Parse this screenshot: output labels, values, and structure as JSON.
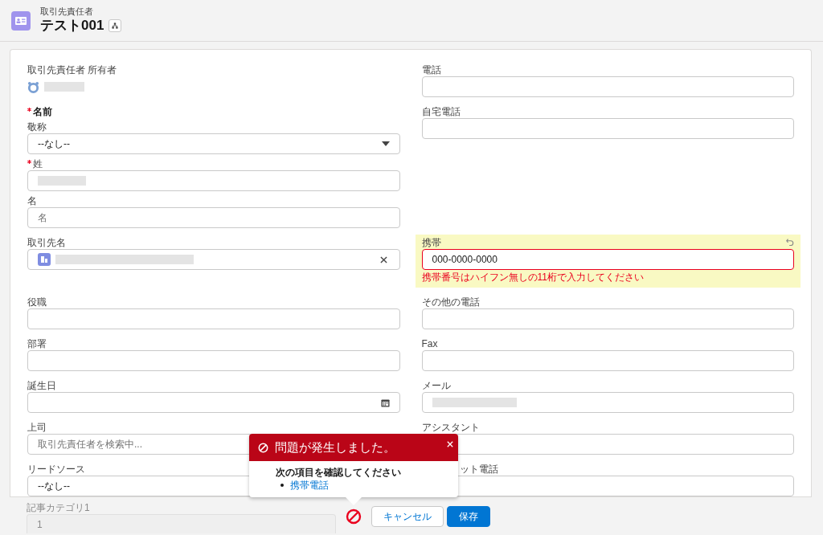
{
  "header": {
    "object_type": "取引先責任者",
    "title": "テスト001"
  },
  "rows": [
    {
      "left": {
        "kind": "owner",
        "label": "取引先責任者 所有者"
      },
      "right": {
        "kind": "text",
        "label": "電話"
      }
    },
    {
      "left": {
        "kind": "name",
        "label": "名前",
        "required": true,
        "subfields": [
          {
            "kind": "select",
            "label": "敬称",
            "value": "--なし--"
          },
          {
            "kind": "text",
            "label": "姓",
            "required": true,
            "redacted": true
          },
          {
            "kind": "text",
            "label": "名",
            "placeholder": "名"
          }
        ]
      },
      "right": {
        "kind": "text",
        "label": "自宅電話"
      }
    },
    {
      "left": {
        "kind": "lookup",
        "label": "取引先名",
        "redacted": true
      },
      "right": {
        "kind": "text",
        "label": "携帯",
        "value": "000-0000-0000",
        "changed": true,
        "error": "携帯番号はハイフン無しの11桁で入力してください"
      }
    },
    {
      "left": {
        "kind": "text",
        "label": "役職"
      },
      "right": {
        "kind": "text",
        "label": "その他の電話"
      }
    },
    {
      "left": {
        "kind": "text",
        "label": "部署"
      },
      "right": {
        "kind": "text",
        "label": "Fax"
      }
    },
    {
      "left": {
        "kind": "date",
        "label": "誕生日"
      },
      "right": {
        "kind": "text",
        "label": "メール",
        "redacted": true
      }
    },
    {
      "left": {
        "kind": "text",
        "label": "上司",
        "placeholder": "取引先責任者を検索中..."
      },
      "right": {
        "kind": "text",
        "label": "アシスタント"
      }
    },
    {
      "left": {
        "kind": "select",
        "label": "リードソース",
        "value": "--なし--",
        "covered": true
      },
      "right": {
        "kind": "text",
        "label": "ット電話",
        "covered": true
      }
    },
    {
      "left": {
        "kind": "text",
        "label": "記事カテゴリ1",
        "value": "1",
        "disabled": true
      }
    }
  ],
  "footer": {
    "buttons": [
      {
        "label": "キャンセル",
        "kind": "neutral"
      },
      {
        "label": "保存",
        "kind": "brand"
      }
    ]
  },
  "error_popup": {
    "title": "問題が発生しました。",
    "message": "次の項目を確認してください",
    "fields": [
      "携帯電話"
    ]
  }
}
